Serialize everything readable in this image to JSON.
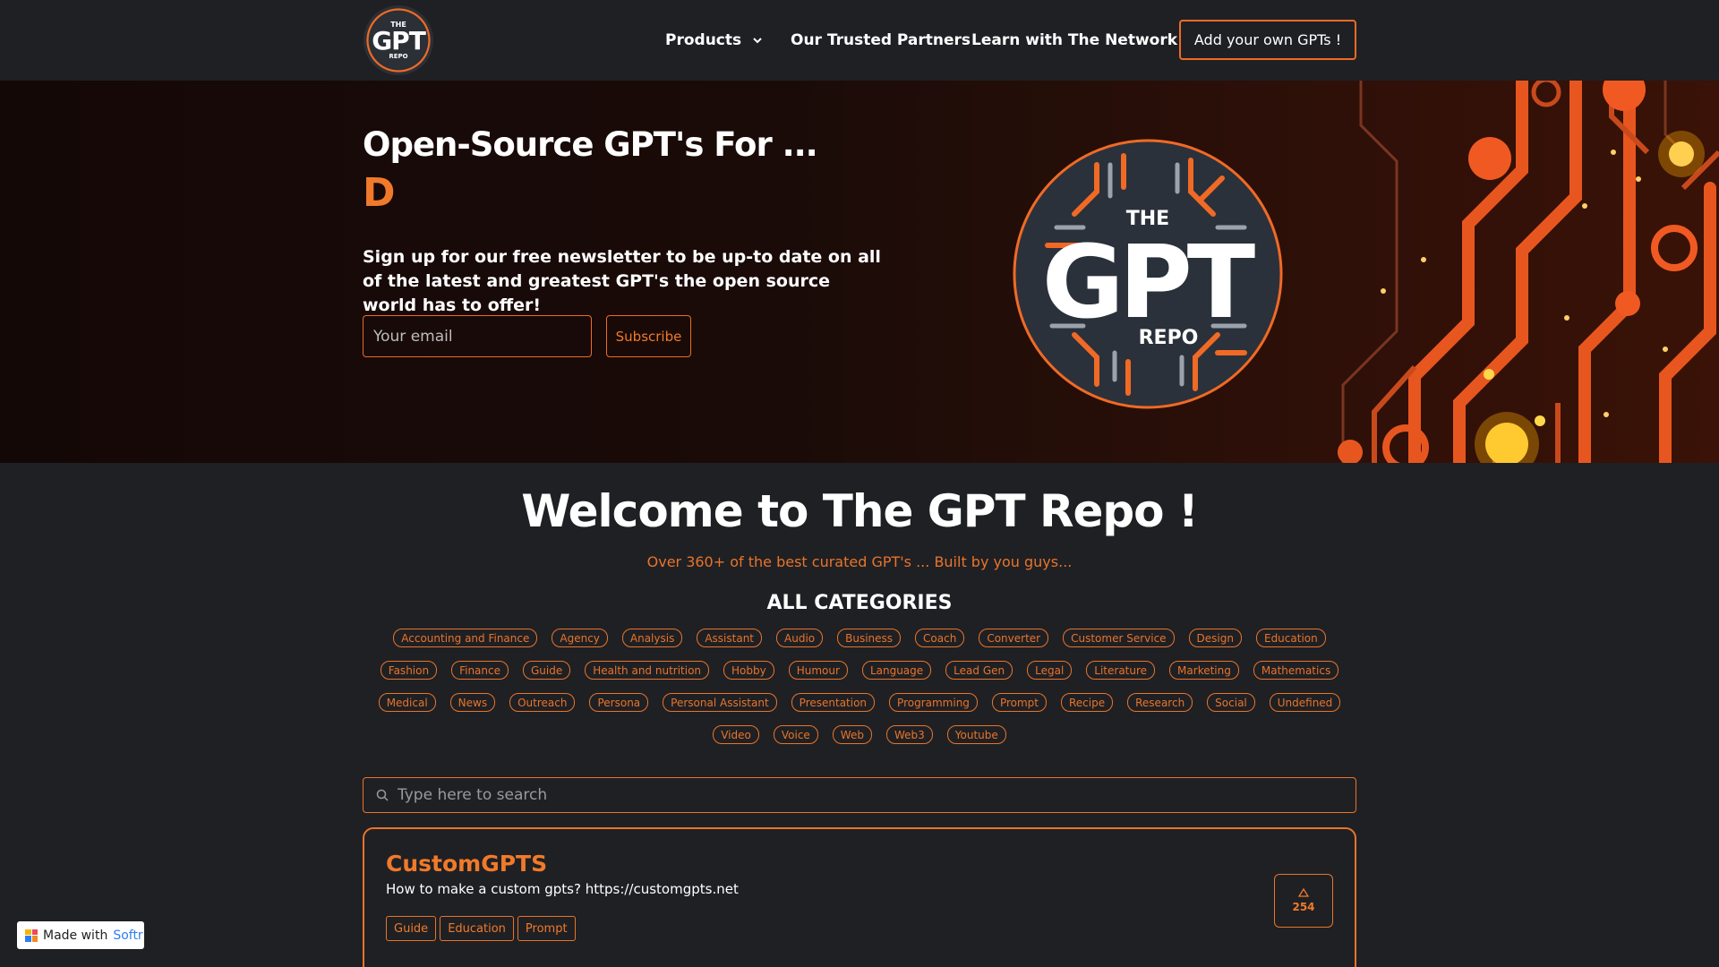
{
  "header": {
    "logo": {
      "the": "THE",
      "gpt": "GPT",
      "repo": "REPO"
    },
    "nav": [
      {
        "label": "Products"
      },
      {
        "label": "Our Trusted Partners"
      },
      {
        "label": "Learn with The Network"
      }
    ],
    "cta_label": "Add your own GPTs !"
  },
  "hero": {
    "title": "Open-Source GPT's For ...",
    "rotating_text": "D",
    "description": "Sign up for our free newsletter to be up-to date on all of the latest and greatest GPT's the open source world has to offer!",
    "email_placeholder": "Your email",
    "subscribe_label": "Subscribe",
    "art": {
      "the": "THE",
      "gpt": "GPT",
      "repo": "REPO"
    }
  },
  "main": {
    "welcome": "Welcome to The GPT Repo !",
    "subtitle": "Over 360+ of the best curated GPT's ... Built by you guys...",
    "categories_title": "ALL CATEGORIES",
    "categories": [
      "Accounting and Finance",
      "Agency",
      "Analysis",
      "Assistant",
      "Audio",
      "Business",
      "Coach",
      "Converter",
      "Customer Service",
      "Design",
      "Education",
      "Fashion",
      "Finance",
      "Guide",
      "Health and nutrition",
      "Hobby",
      "Humour",
      "Language",
      "Lead Gen",
      "Legal",
      "Literature",
      "Marketing",
      "Mathematics",
      "Medical",
      "News",
      "Outreach",
      "Persona",
      "Personal Assistant",
      "Presentation",
      "Programming",
      "Prompt",
      "Recipe",
      "Research",
      "Social",
      "Undefined",
      "Video",
      "Voice",
      "Web",
      "Web3",
      "Youtube"
    ],
    "search_placeholder": "Type here to search",
    "card": {
      "title": "CustomGPTS",
      "description": "How to make a custom gpts? https://customgpts.net",
      "tags": [
        "Guide",
        "Education",
        "Prompt"
      ],
      "votes": "254"
    }
  },
  "badge": {
    "made_with": "Made with",
    "brand": "Softr"
  },
  "colors": {
    "accent": "#f06a25",
    "background": "#1f2024"
  }
}
